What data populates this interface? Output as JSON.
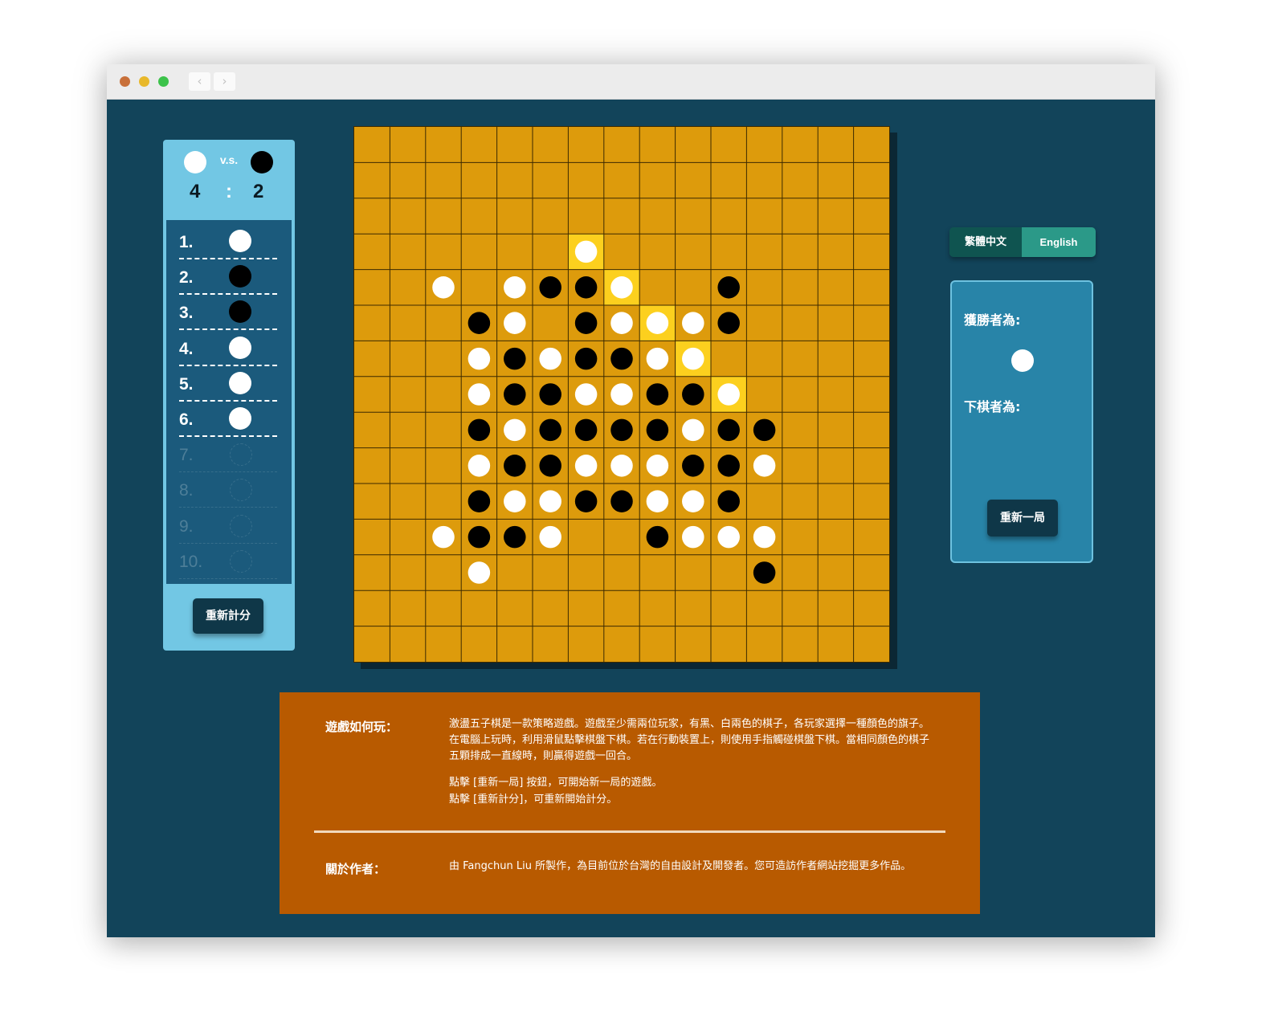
{
  "browser": {
    "back_label": "‹",
    "forward_label": "›"
  },
  "score": {
    "vs_label": "v.s.",
    "white_wins": "4",
    "separator": ":",
    "black_wins": "2"
  },
  "rounds": [
    {
      "label": "1.",
      "winner": "white"
    },
    {
      "label": "2.",
      "winner": "black"
    },
    {
      "label": "3.",
      "winner": "black"
    },
    {
      "label": "4.",
      "winner": "white"
    },
    {
      "label": "5.",
      "winner": "white"
    },
    {
      "label": "6.",
      "winner": "white"
    },
    {
      "label": "7.",
      "winner": ""
    },
    {
      "label": "8.",
      "winner": ""
    },
    {
      "label": "9.",
      "winner": ""
    },
    {
      "label": "10.",
      "winner": ""
    }
  ],
  "reset_score_label": "重新計分",
  "board": {
    "size": 15,
    "colors": {
      "wood": "#dd9b0c",
      "highlight": "#fcd01e",
      "line": "#3d2a00"
    },
    "stones": [
      {
        "r": 3,
        "c": 6,
        "color": "white",
        "highlight": true
      },
      {
        "r": 4,
        "c": 2,
        "color": "white"
      },
      {
        "r": 4,
        "c": 4,
        "color": "white"
      },
      {
        "r": 4,
        "c": 5,
        "color": "black"
      },
      {
        "r": 4,
        "c": 6,
        "color": "black"
      },
      {
        "r": 4,
        "c": 7,
        "color": "white",
        "highlight": true
      },
      {
        "r": 4,
        "c": 10,
        "color": "black"
      },
      {
        "r": 5,
        "c": 3,
        "color": "black"
      },
      {
        "r": 5,
        "c": 4,
        "color": "white"
      },
      {
        "r": 5,
        "c": 6,
        "color": "black"
      },
      {
        "r": 5,
        "c": 7,
        "color": "white"
      },
      {
        "r": 5,
        "c": 8,
        "color": "white",
        "highlight": true
      },
      {
        "r": 5,
        "c": 9,
        "color": "white"
      },
      {
        "r": 5,
        "c": 10,
        "color": "black"
      },
      {
        "r": 6,
        "c": 3,
        "color": "white"
      },
      {
        "r": 6,
        "c": 4,
        "color": "black"
      },
      {
        "r": 6,
        "c": 5,
        "color": "white"
      },
      {
        "r": 6,
        "c": 6,
        "color": "black"
      },
      {
        "r": 6,
        "c": 7,
        "color": "black"
      },
      {
        "r": 6,
        "c": 8,
        "color": "white"
      },
      {
        "r": 6,
        "c": 9,
        "color": "white",
        "highlight": true
      },
      {
        "r": 7,
        "c": 3,
        "color": "white"
      },
      {
        "r": 7,
        "c": 4,
        "color": "black"
      },
      {
        "r": 7,
        "c": 5,
        "color": "black"
      },
      {
        "r": 7,
        "c": 6,
        "color": "white"
      },
      {
        "r": 7,
        "c": 7,
        "color": "white"
      },
      {
        "r": 7,
        "c": 8,
        "color": "black"
      },
      {
        "r": 7,
        "c": 9,
        "color": "black"
      },
      {
        "r": 7,
        "c": 10,
        "color": "white",
        "highlight": true
      },
      {
        "r": 8,
        "c": 3,
        "color": "black"
      },
      {
        "r": 8,
        "c": 4,
        "color": "white"
      },
      {
        "r": 8,
        "c": 5,
        "color": "black"
      },
      {
        "r": 8,
        "c": 6,
        "color": "black"
      },
      {
        "r": 8,
        "c": 7,
        "color": "black"
      },
      {
        "r": 8,
        "c": 8,
        "color": "black"
      },
      {
        "r": 8,
        "c": 9,
        "color": "white"
      },
      {
        "r": 8,
        "c": 10,
        "color": "black"
      },
      {
        "r": 8,
        "c": 11,
        "color": "black"
      },
      {
        "r": 9,
        "c": 3,
        "color": "white"
      },
      {
        "r": 9,
        "c": 4,
        "color": "black"
      },
      {
        "r": 9,
        "c": 5,
        "color": "black"
      },
      {
        "r": 9,
        "c": 6,
        "color": "white"
      },
      {
        "r": 9,
        "c": 7,
        "color": "white"
      },
      {
        "r": 9,
        "c": 8,
        "color": "white"
      },
      {
        "r": 9,
        "c": 9,
        "color": "black"
      },
      {
        "r": 9,
        "c": 10,
        "color": "black"
      },
      {
        "r": 9,
        "c": 11,
        "color": "white"
      },
      {
        "r": 10,
        "c": 3,
        "color": "black"
      },
      {
        "r": 10,
        "c": 4,
        "color": "white"
      },
      {
        "r": 10,
        "c": 5,
        "color": "white"
      },
      {
        "r": 10,
        "c": 6,
        "color": "black"
      },
      {
        "r": 10,
        "c": 7,
        "color": "black"
      },
      {
        "r": 10,
        "c": 8,
        "color": "white"
      },
      {
        "r": 10,
        "c": 9,
        "color": "white"
      },
      {
        "r": 10,
        "c": 10,
        "color": "black"
      },
      {
        "r": 11,
        "c": 2,
        "color": "white"
      },
      {
        "r": 11,
        "c": 3,
        "color": "black"
      },
      {
        "r": 11,
        "c": 4,
        "color": "black"
      },
      {
        "r": 11,
        "c": 5,
        "color": "white"
      },
      {
        "r": 11,
        "c": 8,
        "color": "black"
      },
      {
        "r": 11,
        "c": 9,
        "color": "white"
      },
      {
        "r": 11,
        "c": 10,
        "color": "white"
      },
      {
        "r": 11,
        "c": 11,
        "color": "white"
      },
      {
        "r": 12,
        "c": 3,
        "color": "white"
      },
      {
        "r": 12,
        "c": 11,
        "color": "black"
      }
    ]
  },
  "language": {
    "zh_label": "繁體中文",
    "en_label": "English"
  },
  "status": {
    "winner_label": "獲勝者為:",
    "winner": "white",
    "turn_label": "下棋者為:",
    "new_game_label": "重新一局"
  },
  "info": {
    "howto_heading": "遊戲如何玩：",
    "howto_text": "激盪五子棋是一款策略遊戲。遊戲至少需兩位玩家，有黑、白兩色的棋子，各玩家選擇一種顏色的旗子。在電腦上玩時，利用滑鼠點擊棋盤下棋。若在行動裝置上，則使用手指觸碰棋盤下棋。當相同顏色的棋子五顆排成一直線時，則贏得遊戲一回合。",
    "howto_line1": "點擊 [重新一局] 按鈕，可開始新一局的遊戲。",
    "howto_line2": "點擊 [重新計分]，可重新開始計分。",
    "about_heading": "關於作者：",
    "about_text": "由 Fangchun Liu 所製作，為目前位於台灣的自由設計及開發者。您可造訪作者網站挖掘更多作品。"
  }
}
